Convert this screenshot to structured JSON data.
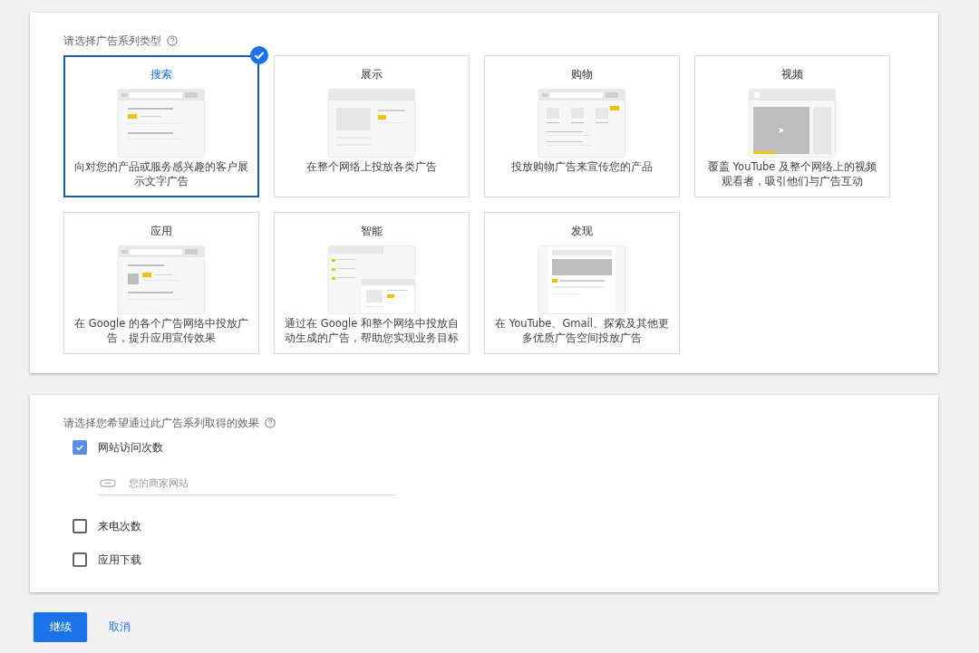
{
  "campaign_type": {
    "title": "请选择广告系列类型",
    "types": [
      {
        "kind": "search",
        "label": "搜索",
        "description": "向对您的产品或服务感兴趣的客户展示文字广告",
        "selected": true
      },
      {
        "kind": "display",
        "label": "展示",
        "description": "在整个网络上投放各类广告",
        "selected": false
      },
      {
        "kind": "shopping",
        "label": "购物",
        "description": "投放购物广告来宣传您的产品",
        "selected": false
      },
      {
        "kind": "video",
        "label": "视频",
        "description": "覆盖 YouTube 及整个网络上的视频观看者，吸引他们与广告互动",
        "selected": false
      },
      {
        "kind": "app",
        "label": "应用",
        "description": "在 Google 的各个广告网络中投放广告，提升应用宣传效果",
        "selected": false
      },
      {
        "kind": "smart",
        "label": "智能",
        "description": "通过在 Google 和整个网络中投放自动生成的广告，帮助您实现业务目标",
        "selected": false
      },
      {
        "kind": "discovery",
        "label": "发现",
        "description": "在 YouTube、Gmail、探索及其他更多优质广告空间投放广告",
        "selected": false
      }
    ]
  },
  "goals": {
    "title": "请选择您希望通过此广告系列取得的效果",
    "options": [
      {
        "label": "网站访问次数",
        "checked": true,
        "field": {
          "placeholder": "您的商家网站"
        }
      },
      {
        "label": "来电次数",
        "checked": false
      },
      {
        "label": "应用下载",
        "checked": false
      }
    ]
  },
  "actions": {
    "primary": "继续",
    "secondary": "取消"
  }
}
